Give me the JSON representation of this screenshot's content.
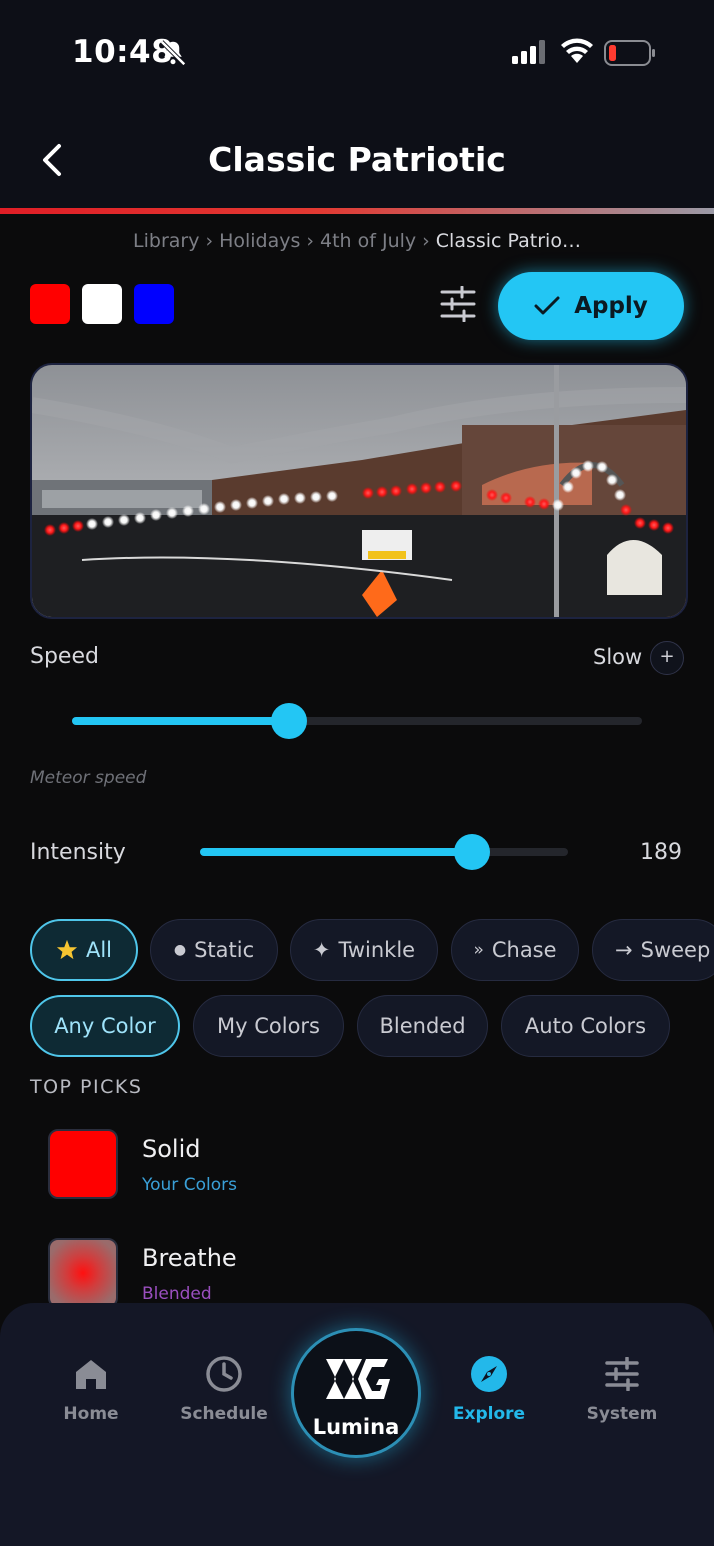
{
  "status_bar": {
    "time": "10:48"
  },
  "header": {
    "title": "Classic Patriotic"
  },
  "breadcrumb": {
    "items": [
      "Library",
      "Holidays",
      "4th of July"
    ],
    "current": "Classic Patrio…"
  },
  "palette": {
    "colors": [
      "#ff0000",
      "#ffffff",
      "#0000ff"
    ]
  },
  "apply_button": {
    "label": "Apply"
  },
  "speed": {
    "label": "Speed",
    "value_label": "Slow",
    "plus": "+",
    "level": 0.38,
    "hint": "Meteor speed"
  },
  "intensity": {
    "label": "Intensity",
    "value": "189",
    "level": 0.74
  },
  "effect_filters": [
    {
      "label": "All",
      "icon": "star-icon",
      "active": true
    },
    {
      "label": "Static",
      "icon": "dot-icon",
      "active": false
    },
    {
      "label": "Twinkle",
      "icon": "sparkle-icon",
      "active": false
    },
    {
      "label": "Chase",
      "icon": "chevrons-right-icon",
      "active": false
    },
    {
      "label": "Sweep",
      "icon": "arrow-right-icon",
      "active": false
    }
  ],
  "color_filters": [
    {
      "label": "Any Color",
      "active": true
    },
    {
      "label": "My Colors",
      "active": false
    },
    {
      "label": "Blended",
      "active": false
    },
    {
      "label": "Auto Colors",
      "active": false
    }
  ],
  "top_picks": {
    "title": "TOP PICKS",
    "items": [
      {
        "name": "Solid",
        "category": "Your Colors",
        "category_color": "#3aa0d8"
      },
      {
        "name": "Breathe",
        "category": "Blended",
        "category_color": "#9b4fc0"
      }
    ]
  },
  "nav": {
    "items": [
      {
        "label": "Home",
        "icon": "home-icon"
      },
      {
        "label": "Schedule",
        "icon": "clock-icon"
      },
      {
        "label": "Lumina",
        "icon": "lumina-logo-icon"
      },
      {
        "label": "Explore",
        "icon": "compass-icon",
        "active": true
      },
      {
        "label": "System",
        "icon": "sliders-icon"
      }
    ]
  },
  "accent_color": "#23c6f4"
}
